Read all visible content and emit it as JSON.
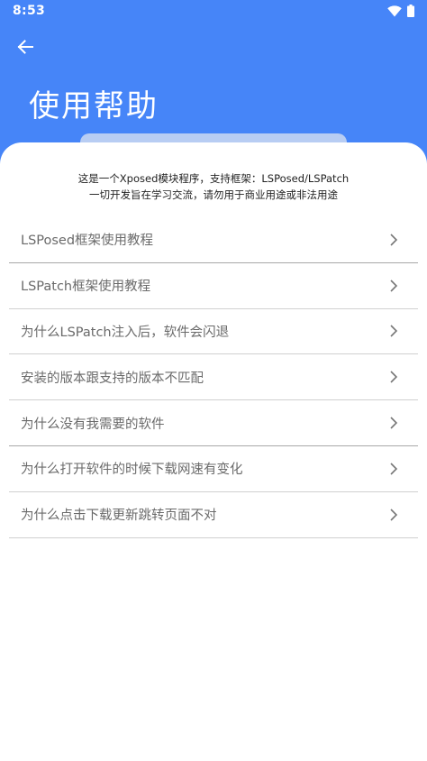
{
  "status_bar": {
    "time": "8:53",
    "icons": [
      "wifi-icon",
      "battery-icon"
    ]
  },
  "header": {
    "back_icon": "arrow-left-icon",
    "title": "使用帮助",
    "color": "#4685f8"
  },
  "notice": {
    "line1": "这是一个Xposed模块程序，支持框架：LSPosed/LSPatch",
    "line2": "一切开发旨在学习交流，请勿用于商业用途或非法用途"
  },
  "help_items": [
    {
      "label": "LSPosed框架使用教程"
    },
    {
      "label": "LSPatch框架使用教程"
    },
    {
      "label": "为什么LSPatch注入后，软件会闪退"
    },
    {
      "label": "安装的版本跟支持的版本不匹配"
    },
    {
      "label": "为什么没有我需要的软件"
    },
    {
      "label": "为什么打开软件的时候下载网速有变化"
    },
    {
      "label": "为什么点击下载更新跳转页面不对"
    }
  ]
}
